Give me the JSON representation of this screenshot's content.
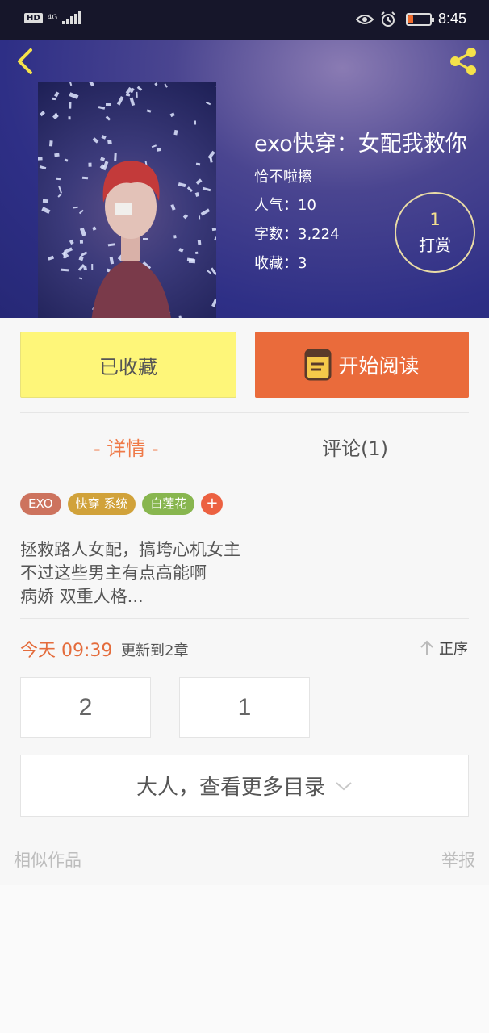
{
  "status_bar": {
    "hd_badge": "HD",
    "network": "4G",
    "time": "8:45",
    "battery_level": 0.25,
    "battery_color": "#f06b2d",
    "icons": [
      "hd-badge",
      "signal-icon",
      "eye-icon",
      "alarm-icon",
      "battery-icon"
    ]
  },
  "header": {
    "back_icon": "chevron-left-icon",
    "share_icon": "share-icon",
    "accent_color": "#f5e24a"
  },
  "book": {
    "title": "exo快穿：女配我救你",
    "author": "恰不啦擦",
    "popularity": "人气：10",
    "word_count": "字数：3,224",
    "favorites": "收藏：3",
    "reward_count": "1",
    "reward_label": "打赏"
  },
  "actions": {
    "favorite_label": "已收藏",
    "favorite_color": "#fef679",
    "read_label": "开始阅读",
    "read_color": "#ea6b3b",
    "read_icon": "book-icon"
  },
  "tabs": {
    "detail": "- 详情 -",
    "comments": "评论(1)",
    "active_color": "#ef7a48"
  },
  "tags": {
    "items": [
      {
        "label": "EXO",
        "color": "#cd735e"
      },
      {
        "label": "快穿  系统",
        "color": "#d1a23a"
      },
      {
        "label": "白莲花",
        "color": "#88b64f"
      }
    ],
    "add_label": "+"
  },
  "description": "拯救路人女配，搞垮心机女主\n不过这些男主有点高能啊\n病娇 双重人格...",
  "update": {
    "time": "今天 09:39",
    "text": "更新到2章",
    "order_label": "正序",
    "order_icon": "arrow-up-icon"
  },
  "chapters": [
    "2",
    "1"
  ],
  "more_catalog": {
    "label": "大人，查看更多目录",
    "icon": "chevron-down-icon"
  },
  "footer": {
    "similar": "相似作品",
    "report": "举报"
  }
}
